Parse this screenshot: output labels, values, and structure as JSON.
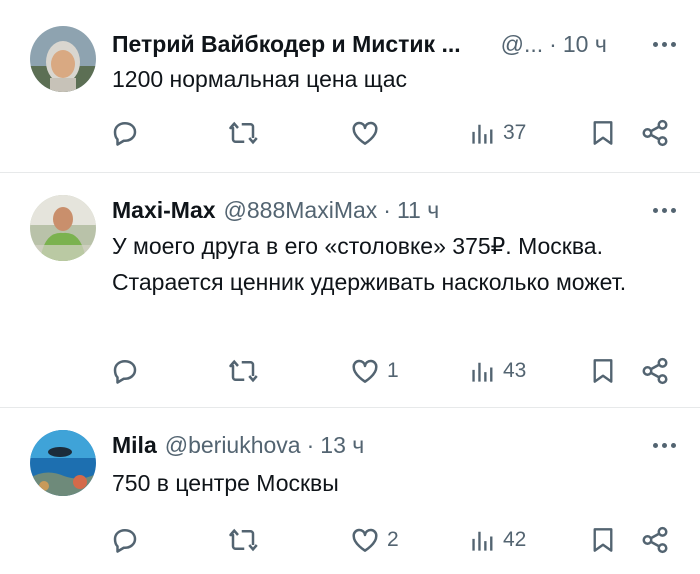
{
  "tweets": [
    {
      "name": "Петрий Вайбкодер и Мистик ...",
      "handle": "@...",
      "separator": "·",
      "time": "10 ч",
      "text": "1200 нормальная цена щас",
      "likes": "",
      "views": "37"
    },
    {
      "name": "Maxi-Max",
      "handle": "@888MaxiMax",
      "separator": "·",
      "time": "11 ч",
      "text": "У моего друга в его «столовке» 375₽. Москва. Старается ценник удерживать насколько может.",
      "likes": "1",
      "views": "43"
    },
    {
      "name": "Mila",
      "handle": "@beriukhova",
      "separator": "·",
      "time": "13 ч",
      "text": "750 в центре Москвы",
      "likes": "2",
      "views": "42"
    }
  ],
  "icons": {
    "reply": "reply-icon",
    "retweet": "retweet-icon",
    "like": "heart-icon",
    "views": "views-icon",
    "bookmark": "bookmark-icon",
    "share": "share-icon",
    "more": "more-icon"
  },
  "colors": {
    "text": "#0f1419",
    "secondary": "#536471",
    "divider": "#e7e9ea"
  }
}
